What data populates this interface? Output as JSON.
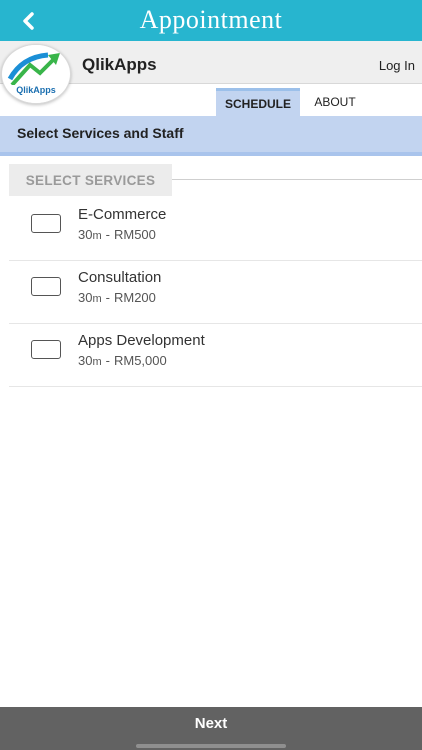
{
  "header": {
    "title": "Appointment",
    "back_icon": "chevron-left-icon",
    "color": "#27b5cf"
  },
  "business": {
    "name": "QlikApps",
    "login_label": "Log In",
    "logo_text": "QlikApps"
  },
  "tabs": [
    {
      "label": "SCHEDULE",
      "active": true
    },
    {
      "label": "ABOUT",
      "active": false
    }
  ],
  "section": {
    "title": "Select Services and Staff",
    "accent": "#c2d4f0"
  },
  "services_group": {
    "label": "SELECT SERVICES",
    "items": [
      {
        "name": "E-Commerce",
        "duration": "30",
        "unit": "m",
        "price": "RM500",
        "checked": false
      },
      {
        "name": "Consultation",
        "duration": "30",
        "unit": "m",
        "price": "RM200",
        "checked": false
      },
      {
        "name": "Apps Development",
        "duration": "30",
        "unit": "m",
        "price": "RM5,000",
        "checked": false
      }
    ]
  },
  "footer": {
    "next_label": "Next"
  }
}
